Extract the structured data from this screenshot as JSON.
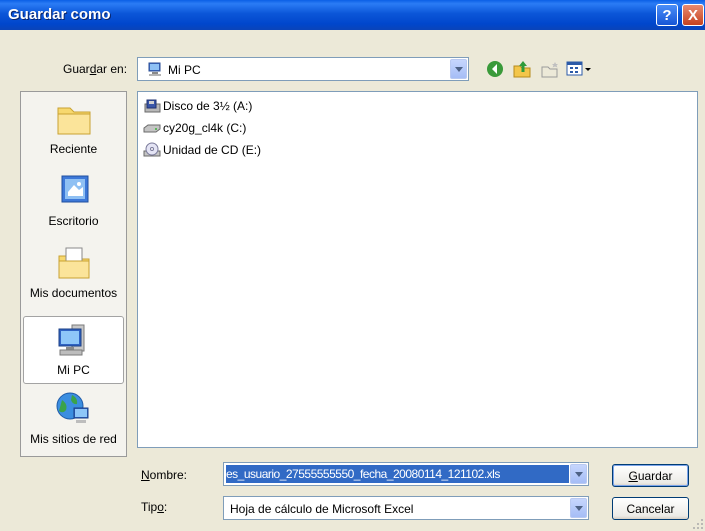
{
  "window": {
    "title": "Guardar como",
    "help_icon": "?",
    "close_icon": "X"
  },
  "toolbar": {
    "save_in_label_pre": "Guar",
    "save_in_label_u": "d",
    "save_in_label_post": "ar en:",
    "location_value": "Mi PC",
    "icons": [
      "back-icon",
      "up-folder-icon",
      "new-folder-icon",
      "views-menu-icon"
    ]
  },
  "places": [
    {
      "label": "Reciente",
      "icon": "recent-folder-icon"
    },
    {
      "label": "Escritorio",
      "icon": "desktop-icon"
    },
    {
      "label": "Mis documentos",
      "icon": "my-documents-icon"
    },
    {
      "label": "Mi PC",
      "icon": "my-computer-icon",
      "selected": true
    },
    {
      "label": "Mis sitios de red",
      "icon": "network-places-icon"
    }
  ],
  "files": [
    {
      "label": "Disco de 3½ (A:)",
      "icon": "floppy-drive-icon"
    },
    {
      "label": "cy20g_cl4k (C:)",
      "icon": "hard-drive-icon"
    },
    {
      "label": "Unidad de CD (E:)",
      "icon": "cd-drive-icon"
    }
  ],
  "form": {
    "name_label_u": "N",
    "name_label_rest": "ombre:",
    "name_value": "es_usuario_27555555550_fecha_20080114_121102.xls",
    "type_label_pre": "Tip",
    "type_label_u": "o",
    "type_label_post": ":",
    "type_value": "Hoja de cálculo de Microsoft Excel"
  },
  "buttons": {
    "save_u": "G",
    "save_rest": "uardar",
    "cancel": "Cancelar"
  },
  "colors": {
    "titlebar": "#0046cc",
    "dialog_bg": "#ece9d8",
    "selection": "#316ac5"
  }
}
